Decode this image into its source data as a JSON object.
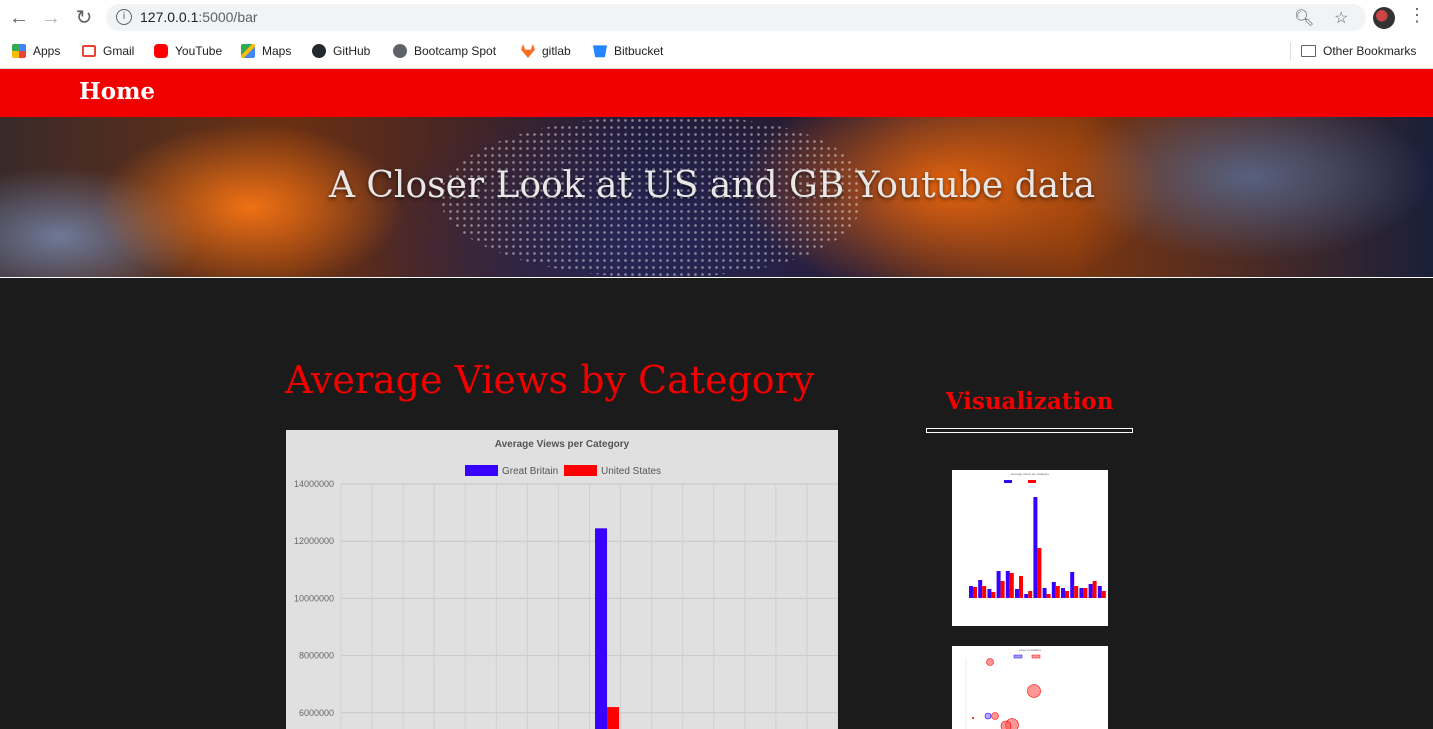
{
  "browser": {
    "url_host": "127.0.0.1",
    "url_path": ":5000/bar",
    "bookmarks": [
      {
        "label": "Apps",
        "icon": "apps-grid-icon",
        "color": "#4285f4"
      },
      {
        "label": "Gmail",
        "icon": "gmail-icon",
        "color": "#ea4335"
      },
      {
        "label": "YouTube",
        "icon": "youtube-icon",
        "color": "#ff0000"
      },
      {
        "label": "Maps",
        "icon": "maps-icon",
        "color": "#34a853"
      },
      {
        "label": "GitHub",
        "icon": "github-icon",
        "color": "#24292e"
      },
      {
        "label": "Bootcamp Spot",
        "icon": "globe-icon",
        "color": "#5f6368"
      },
      {
        "label": "gitlab",
        "icon": "gitlab-icon",
        "color": "#fc6d26"
      },
      {
        "label": "Bitbucket",
        "icon": "bitbucket-icon",
        "color": "#2684ff"
      }
    ],
    "other_bookmarks": "Other Bookmarks"
  },
  "navbar": {
    "brand": "Home",
    "color": "#f20000"
  },
  "hero": {
    "title": "A Closer Look at US and GB Youtube data"
  },
  "main": {
    "heading": "Average Views by Category"
  },
  "sidebar": {
    "title": "Visualization"
  },
  "chart_data": {
    "type": "bar",
    "title": "Average Views per Category",
    "ylim": [
      0,
      14000000
    ],
    "yticks": [
      "14000000",
      "12000000",
      "10000000",
      "8000000",
      "6000000"
    ],
    "legend_position": "top",
    "categories": 16,
    "series": [
      {
        "name": "Great Britain",
        "color": "#3700ff",
        "values": [
          {
            "category_index": 8,
            "value": 12450000
          }
        ]
      },
      {
        "name": "United States",
        "color": "#ff0000",
        "values": [
          {
            "category_index": 8,
            "value": 6200000
          }
        ]
      }
    ]
  },
  "thumbnails": [
    {
      "type": "bar",
      "title": "Average Views per Category"
    },
    {
      "type": "scatter",
      "title": "Likes vs Dislikes"
    }
  ]
}
